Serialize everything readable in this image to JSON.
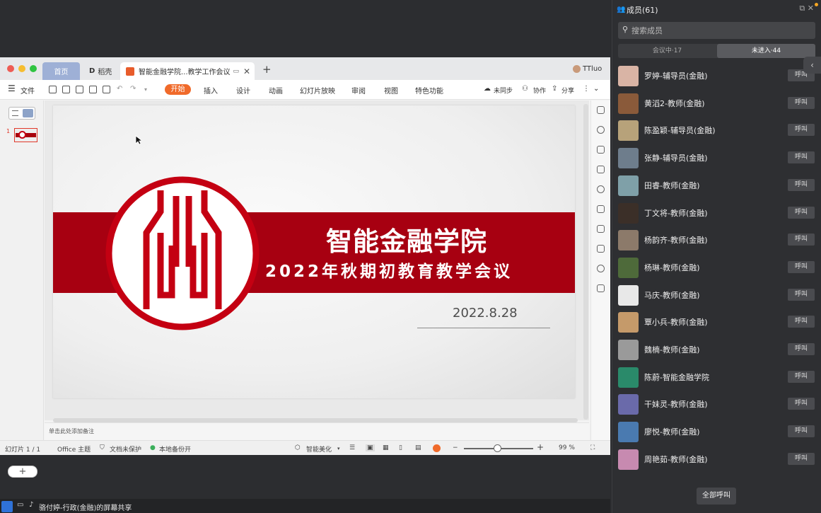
{
  "browser_tabs": {
    "home": "首页",
    "daoke": "稻壳",
    "doc": "智能金融学院...教学工作会议",
    "user": "TTluo"
  },
  "toolbar": {
    "file": "文件",
    "start": "开始",
    "insert": "插入",
    "design": "设计",
    "animation": "动画",
    "slideshow": "幻灯片放映",
    "review": "审阅",
    "view": "视图",
    "special": "特色功能",
    "not_synced": "未同步",
    "collab": "协作",
    "share": "分享"
  },
  "slide": {
    "title": "智能金融学院",
    "subtitle": "2022年秋期初教育教学会议",
    "date": "2022.8.28",
    "thumb_number": "1"
  },
  "notes_placeholder": "单击此处添加备注",
  "statusbar": {
    "slide_count": "幻灯片 1 / 1",
    "theme": "Office 主题",
    "protect": "文档未保护",
    "backup": "本地备份开",
    "beautify": "智能美化",
    "zoom": "99 %"
  },
  "share_notice": "骆付婷-行政(金融)的屏幕共享",
  "members_panel": {
    "title": "成员(61)",
    "search_placeholder": "搜索成员",
    "tab_in_meeting": "会议中·17",
    "tab_not_joined": "未进入·44",
    "call_label": "呼叫",
    "call_all": "全部呼叫",
    "members": [
      {
        "name": "罗婷-辅导员(金融)",
        "avatar_color": "#d9b4a5"
      },
      {
        "name": "黄滔2-教师(金融)",
        "avatar_color": "#8a5a3a"
      },
      {
        "name": "陈盈颖-辅导员(金融)",
        "avatar_color": "#b7a27a"
      },
      {
        "name": "张静-辅导员(金融)",
        "avatar_color": "#6e7d8c"
      },
      {
        "name": "田睿-教师(金融)",
        "avatar_color": "#7fa0a8"
      },
      {
        "name": "丁文将-教师(金融)",
        "avatar_color": "#3b2f28"
      },
      {
        "name": "杨韵齐-教师(金融)",
        "avatar_color": "#8c7a6a"
      },
      {
        "name": "杨琳-教师(金融)",
        "avatar_color": "#4e6a3a"
      },
      {
        "name": "马庆-教师(金融)",
        "avatar_color": "#e8e8e8"
      },
      {
        "name": "覃小兵-教师(金融)",
        "avatar_color": "#c59a6a"
      },
      {
        "name": "魏楠-教师(金融)",
        "avatar_color": "#9a9a9a"
      },
      {
        "name": "陈蔚-智能金融学院",
        "avatar_color": "#2a8a6a"
      },
      {
        "name": "干妹灵-教师(金融)",
        "avatar_color": "#6a6aaa"
      },
      {
        "name": "廖悦-教师(金融)",
        "avatar_color": "#4a7ab0"
      },
      {
        "name": "周艳茹-教师(金融)",
        "avatar_color": "#c78ab0"
      }
    ]
  }
}
